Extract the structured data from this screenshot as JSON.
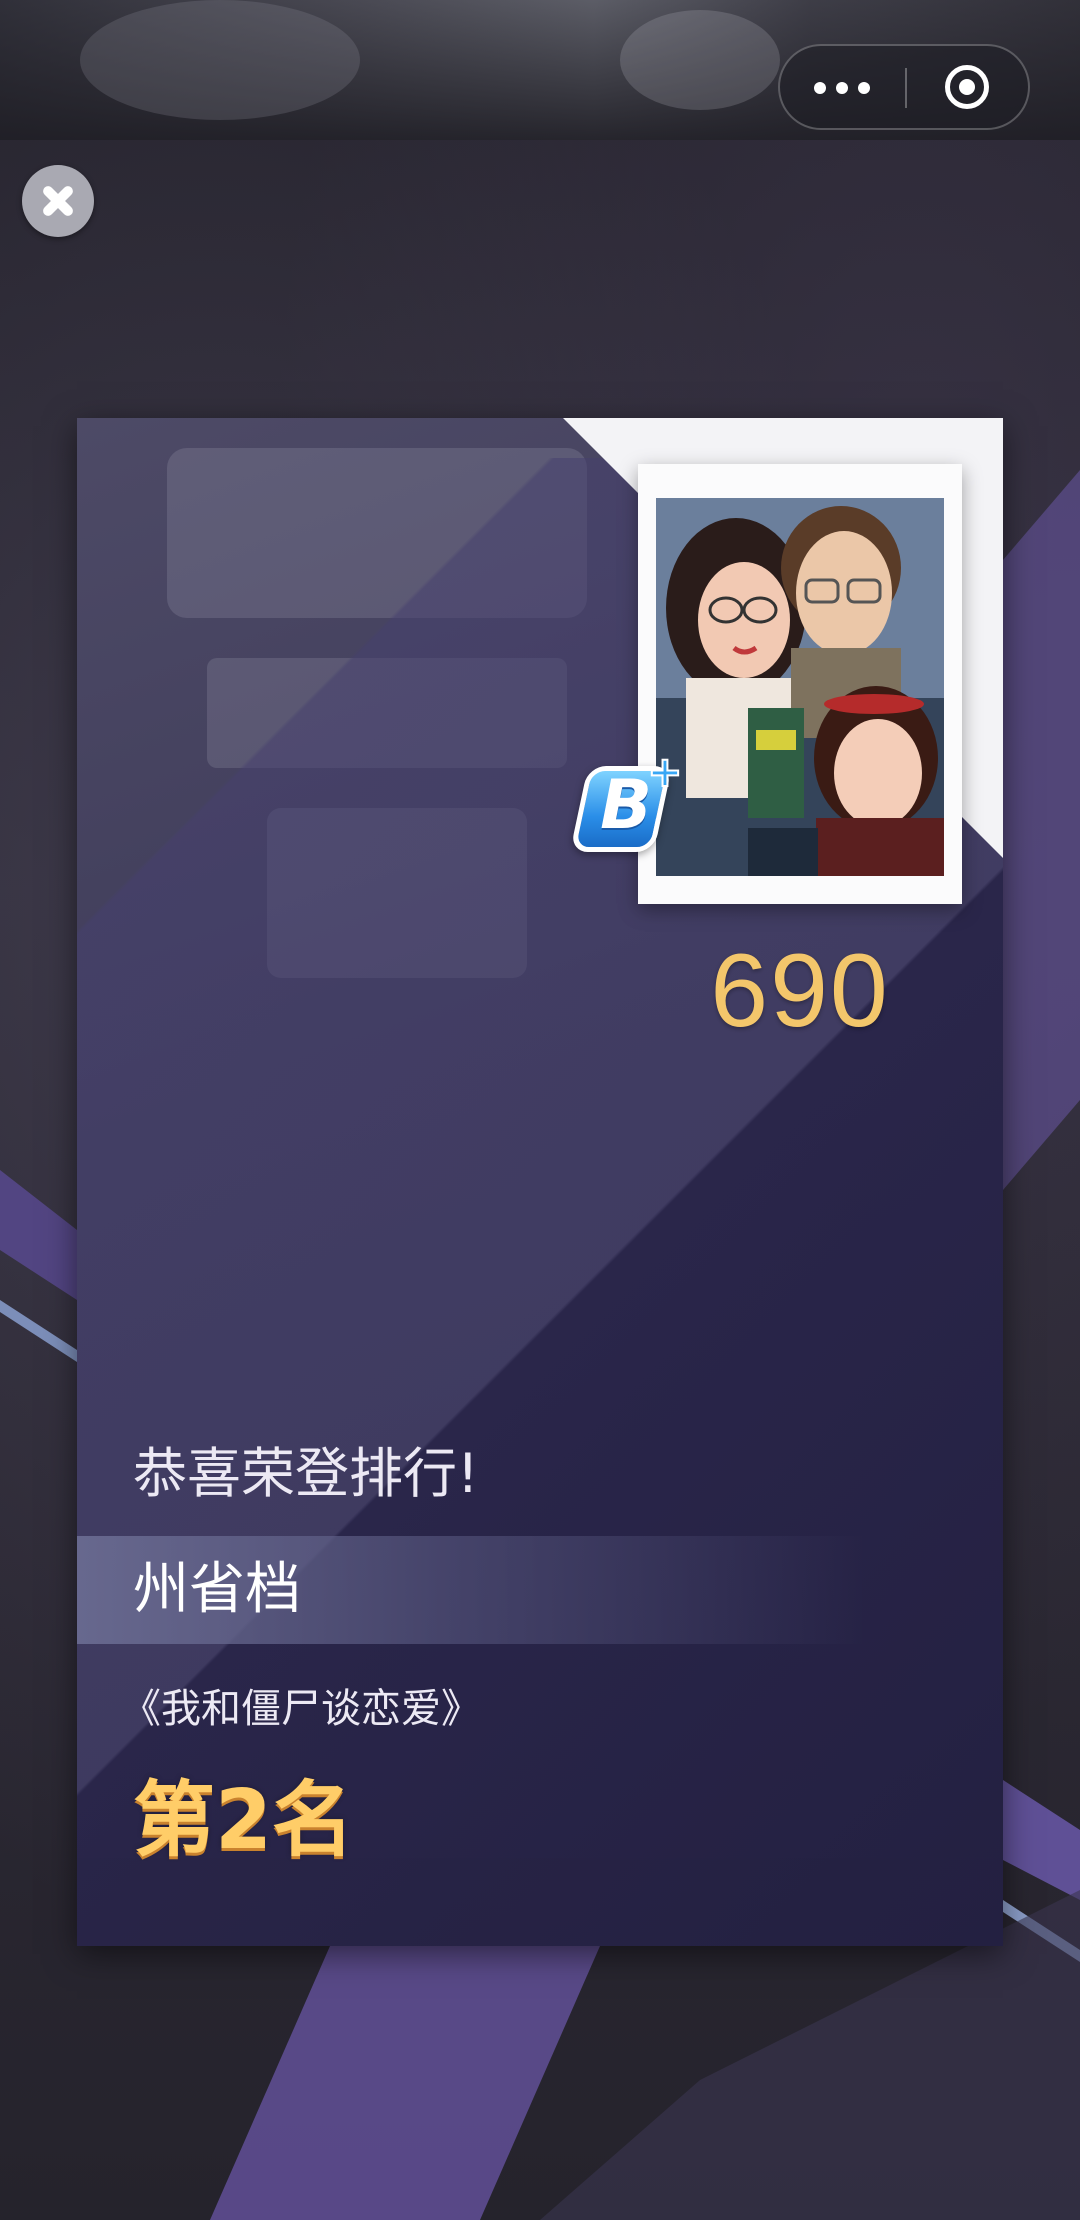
{
  "topbar": {
    "more_icon": "more-dots-icon",
    "target_icon": "target-icon"
  },
  "close_icon": "close-icon",
  "card": {
    "grade": {
      "letter": "B",
      "modifier": "+"
    },
    "score": "690",
    "congrats_text": "恭喜荣登排行!",
    "category": "州省档",
    "movie_title": "《我和僵尸谈恋爱》",
    "rank_text": "第2名"
  },
  "colors": {
    "score": "#f3c66b",
    "rank": "#ffcd68",
    "card_bg": "#3b3854",
    "accent_purple": "#7b64b4"
  }
}
